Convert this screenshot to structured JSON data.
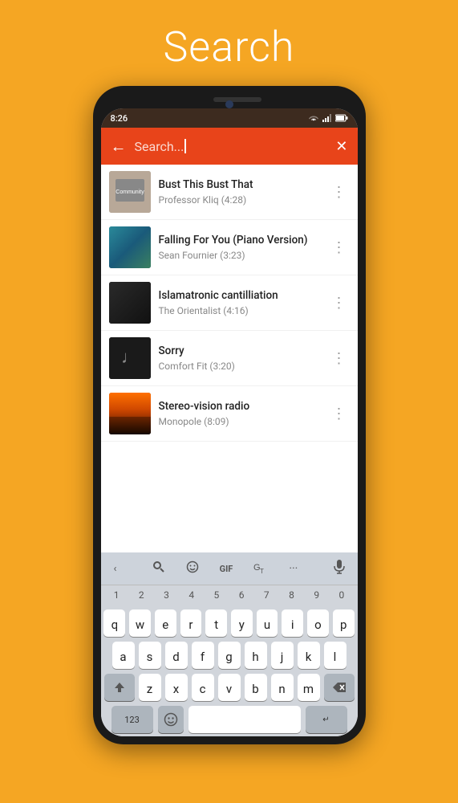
{
  "header": {
    "title": "Search"
  },
  "status_bar": {
    "time": "8:26",
    "icons": [
      "signal",
      "wifi",
      "battery"
    ]
  },
  "search": {
    "placeholder": "Search...",
    "value": ""
  },
  "songs": [
    {
      "id": 1,
      "title": "Bust This Bust That",
      "artist": "Professor Kliq",
      "duration": "4:28",
      "thumb_type": "community"
    },
    {
      "id": 2,
      "title": "Falling For You (Piano Version)",
      "artist": "Sean Fournier",
      "duration": "3:23",
      "thumb_type": "falling"
    },
    {
      "id": 3,
      "title": "Islamatronic cantilliation",
      "artist": "The Orientalist",
      "duration": "4:16",
      "thumb_type": "islamatronic"
    },
    {
      "id": 4,
      "title": "Sorry",
      "artist": "Comfort Fit",
      "duration": "3:20",
      "thumb_type": "sorry"
    },
    {
      "id": 5,
      "title": "Stereo-vision radio",
      "artist": "Monopole",
      "duration": "8:09",
      "thumb_type": "stereo"
    }
  ],
  "keyboard": {
    "rows": [
      [
        "q",
        "w",
        "e",
        "r",
        "t",
        "y",
        "u",
        "i",
        "o",
        "p"
      ],
      [
        "a",
        "s",
        "d",
        "f",
        "g",
        "h",
        "j",
        "k",
        "l"
      ],
      [
        "z",
        "x",
        "c",
        "v",
        "b",
        "n",
        "m"
      ]
    ],
    "numbers": [
      "1",
      "2",
      "3",
      "4",
      "5",
      "6",
      "7",
      "8",
      "9",
      "0"
    ],
    "toolbar": {
      "back_label": "‹",
      "search_label": "🔍",
      "emoji_label": "☺",
      "gif_label": "GIF",
      "translate_label": "G̲T",
      "more_label": "···",
      "mic_label": "🎤"
    }
  },
  "colors": {
    "orange_bg": "#F5A623",
    "header_bar": "#E8441A",
    "status_bar_bg": "#3d2b1f"
  }
}
